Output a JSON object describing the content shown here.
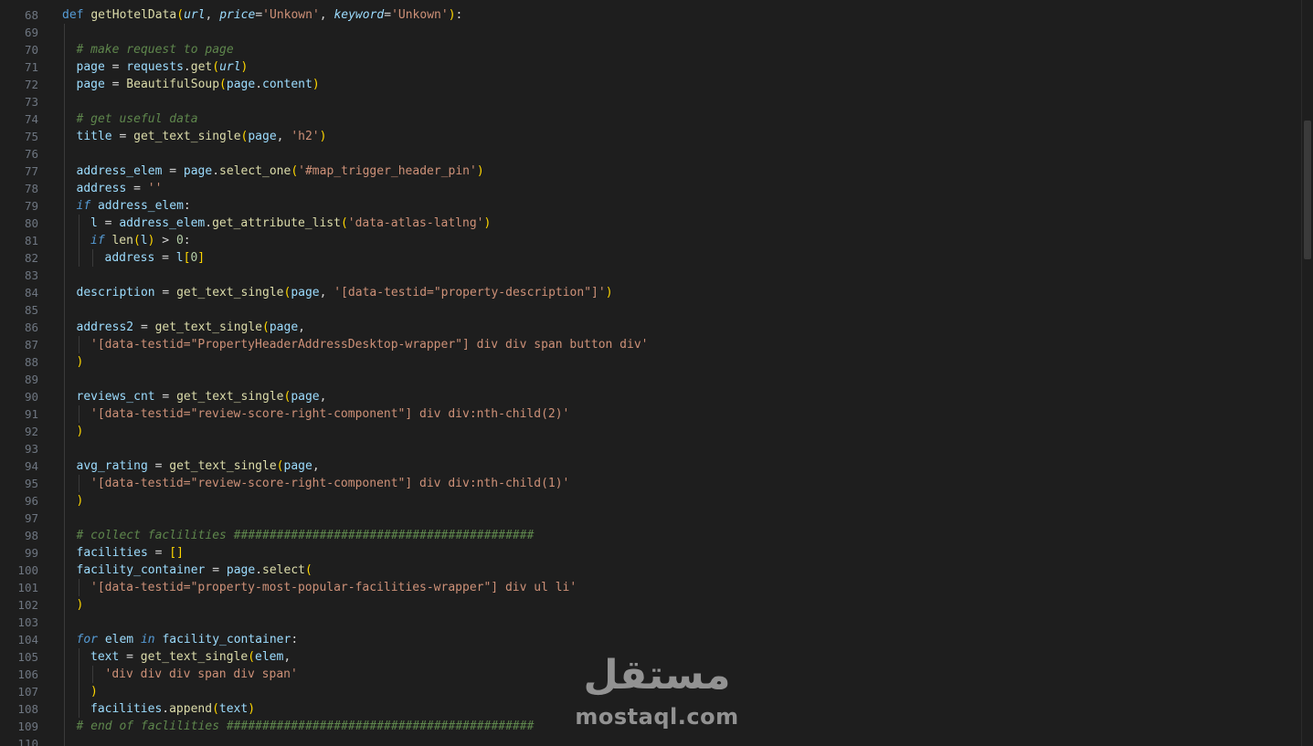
{
  "editor": {
    "line_numbers": [
      "68",
      "69",
      "70",
      "71",
      "72",
      "73",
      "74",
      "75",
      "76",
      "77",
      "78",
      "79",
      "80",
      "81",
      "82",
      "83",
      "84",
      "85",
      "86",
      "87",
      "88",
      "89",
      "90",
      "91",
      "92",
      "93",
      "94",
      "95",
      "96",
      "97",
      "98",
      "99",
      "100",
      "101",
      "102",
      "103",
      "104",
      "105",
      "106",
      "107",
      "108",
      "109",
      "110"
    ],
    "lines": [
      {
        "indent": 0,
        "tokens": [
          [
            "kw",
            "def "
          ],
          [
            "fn",
            "getHotelData"
          ],
          [
            "br1",
            "("
          ],
          [
            "prm",
            "url"
          ],
          [
            "punc",
            ", "
          ],
          [
            "prm",
            "price"
          ],
          [
            "op",
            "="
          ],
          [
            "str",
            "'Unkown'"
          ],
          [
            "punc",
            ", "
          ],
          [
            "prm",
            "keyword"
          ],
          [
            "op",
            "="
          ],
          [
            "str",
            "'Unkown'"
          ],
          [
            "br1",
            ")"
          ],
          [
            "punc",
            ":"
          ]
        ]
      },
      {
        "indent": 1,
        "tokens": []
      },
      {
        "indent": 1,
        "tokens": [
          [
            "com",
            "# make request to page"
          ]
        ]
      },
      {
        "indent": 1,
        "tokens": [
          [
            "var",
            "page"
          ],
          [
            "op",
            " = "
          ],
          [
            "var",
            "requests"
          ],
          [
            "punc",
            "."
          ],
          [
            "fn",
            "get"
          ],
          [
            "br1",
            "("
          ],
          [
            "prm",
            "url"
          ],
          [
            "br1",
            ")"
          ]
        ]
      },
      {
        "indent": 1,
        "tokens": [
          [
            "var",
            "page"
          ],
          [
            "op",
            " = "
          ],
          [
            "fn",
            "BeautifulSoup"
          ],
          [
            "br1",
            "("
          ],
          [
            "var",
            "page"
          ],
          [
            "punc",
            "."
          ],
          [
            "var",
            "content"
          ],
          [
            "br1",
            ")"
          ]
        ]
      },
      {
        "indent": 1,
        "tokens": []
      },
      {
        "indent": 1,
        "tokens": [
          [
            "com",
            "# get useful data"
          ]
        ]
      },
      {
        "indent": 1,
        "tokens": [
          [
            "var",
            "title"
          ],
          [
            "op",
            " = "
          ],
          [
            "fn",
            "get_text_single"
          ],
          [
            "br1",
            "("
          ],
          [
            "var",
            "page"
          ],
          [
            "punc",
            ", "
          ],
          [
            "str",
            "'h2'"
          ],
          [
            "br1",
            ")"
          ]
        ]
      },
      {
        "indent": 1,
        "tokens": []
      },
      {
        "indent": 1,
        "tokens": [
          [
            "var",
            "address_elem"
          ],
          [
            "op",
            " = "
          ],
          [
            "var",
            "page"
          ],
          [
            "punc",
            "."
          ],
          [
            "fn",
            "select_one"
          ],
          [
            "br1",
            "("
          ],
          [
            "str",
            "'#map_trigger_header_pin'"
          ],
          [
            "br1",
            ")"
          ]
        ]
      },
      {
        "indent": 1,
        "tokens": [
          [
            "var",
            "address"
          ],
          [
            "op",
            " = "
          ],
          [
            "str",
            "''"
          ]
        ]
      },
      {
        "indent": 1,
        "tokens": [
          [
            "kwi",
            "if "
          ],
          [
            "var",
            "address_elem"
          ],
          [
            "punc",
            ":"
          ]
        ]
      },
      {
        "indent": 2,
        "tokens": [
          [
            "var",
            "l"
          ],
          [
            "op",
            " = "
          ],
          [
            "var",
            "address_elem"
          ],
          [
            "punc",
            "."
          ],
          [
            "fn",
            "get_attribute_list"
          ],
          [
            "br1",
            "("
          ],
          [
            "str",
            "'data-atlas-latlng'"
          ],
          [
            "br1",
            ")"
          ]
        ]
      },
      {
        "indent": 2,
        "tokens": [
          [
            "kwi",
            "if "
          ],
          [
            "fn",
            "len"
          ],
          [
            "br1",
            "("
          ],
          [
            "var",
            "l"
          ],
          [
            "br1",
            ")"
          ],
          [
            "op",
            " > "
          ],
          [
            "num",
            "0"
          ],
          [
            "punc",
            ":"
          ]
        ]
      },
      {
        "indent": 3,
        "tokens": [
          [
            "var",
            "address"
          ],
          [
            "op",
            " = "
          ],
          [
            "var",
            "l"
          ],
          [
            "br1",
            "["
          ],
          [
            "num",
            "0"
          ],
          [
            "br1",
            "]"
          ]
        ]
      },
      {
        "indent": 1,
        "tokens": []
      },
      {
        "indent": 1,
        "tokens": [
          [
            "var",
            "description"
          ],
          [
            "op",
            " = "
          ],
          [
            "fn",
            "get_text_single"
          ],
          [
            "br1",
            "("
          ],
          [
            "var",
            "page"
          ],
          [
            "punc",
            ", "
          ],
          [
            "str",
            "'[data-testid=\"property-description\"]'"
          ],
          [
            "br1",
            ")"
          ]
        ]
      },
      {
        "indent": 1,
        "tokens": []
      },
      {
        "indent": 1,
        "tokens": [
          [
            "var",
            "address2"
          ],
          [
            "op",
            " = "
          ],
          [
            "fn",
            "get_text_single"
          ],
          [
            "br1",
            "("
          ],
          [
            "var",
            "page"
          ],
          [
            "punc",
            ","
          ]
        ]
      },
      {
        "indent": 2,
        "tokens": [
          [
            "str",
            "'[data-testid=\"PropertyHeaderAddressDesktop-wrapper\"] div div span button div'"
          ]
        ]
      },
      {
        "indent": 1,
        "tokens": [
          [
            "br1",
            ")"
          ]
        ]
      },
      {
        "indent": 1,
        "tokens": []
      },
      {
        "indent": 1,
        "tokens": [
          [
            "var",
            "reviews_cnt"
          ],
          [
            "op",
            " = "
          ],
          [
            "fn",
            "get_text_single"
          ],
          [
            "br1",
            "("
          ],
          [
            "var",
            "page"
          ],
          [
            "punc",
            ","
          ]
        ]
      },
      {
        "indent": 2,
        "tokens": [
          [
            "str",
            "'[data-testid=\"review-score-right-component\"] div div:nth-child(2)'"
          ]
        ]
      },
      {
        "indent": 1,
        "tokens": [
          [
            "br1",
            ")"
          ]
        ]
      },
      {
        "indent": 1,
        "tokens": []
      },
      {
        "indent": 1,
        "tokens": [
          [
            "var",
            "avg_rating"
          ],
          [
            "op",
            " = "
          ],
          [
            "fn",
            "get_text_single"
          ],
          [
            "br1",
            "("
          ],
          [
            "var",
            "page"
          ],
          [
            "punc",
            ","
          ]
        ]
      },
      {
        "indent": 2,
        "tokens": [
          [
            "str",
            "'[data-testid=\"review-score-right-component\"] div div:nth-child(1)'"
          ]
        ]
      },
      {
        "indent": 1,
        "tokens": [
          [
            "br1",
            ")"
          ]
        ]
      },
      {
        "indent": 1,
        "tokens": []
      },
      {
        "indent": 1,
        "tokens": [
          [
            "com",
            "# collect faclilities ##########################################"
          ]
        ]
      },
      {
        "indent": 1,
        "tokens": [
          [
            "var",
            "facilities"
          ],
          [
            "op",
            " = "
          ],
          [
            "br1",
            "[]"
          ]
        ]
      },
      {
        "indent": 1,
        "tokens": [
          [
            "var",
            "facility_container"
          ],
          [
            "op",
            " = "
          ],
          [
            "var",
            "page"
          ],
          [
            "punc",
            "."
          ],
          [
            "fn",
            "select"
          ],
          [
            "br1",
            "("
          ]
        ]
      },
      {
        "indent": 2,
        "tokens": [
          [
            "str",
            "'[data-testid=\"property-most-popular-facilities-wrapper\"] div ul li'"
          ]
        ]
      },
      {
        "indent": 1,
        "tokens": [
          [
            "br1",
            ")"
          ]
        ]
      },
      {
        "indent": 1,
        "tokens": []
      },
      {
        "indent": 1,
        "tokens": [
          [
            "kwi",
            "for "
          ],
          [
            "var",
            "elem "
          ],
          [
            "kwi",
            "in "
          ],
          [
            "var",
            "facility_container"
          ],
          [
            "punc",
            ":"
          ]
        ]
      },
      {
        "indent": 2,
        "tokens": [
          [
            "var",
            "text"
          ],
          [
            "op",
            " = "
          ],
          [
            "fn",
            "get_text_single"
          ],
          [
            "br1",
            "("
          ],
          [
            "var",
            "elem"
          ],
          [
            "punc",
            ","
          ]
        ]
      },
      {
        "indent": 3,
        "tokens": [
          [
            "str",
            "'div div div span div span'"
          ]
        ]
      },
      {
        "indent": 2,
        "tokens": [
          [
            "br1",
            ")"
          ]
        ]
      },
      {
        "indent": 2,
        "tokens": [
          [
            "var",
            "facilities"
          ],
          [
            "punc",
            "."
          ],
          [
            "fn",
            "append"
          ],
          [
            "br1",
            "("
          ],
          [
            "var",
            "text"
          ],
          [
            "br1",
            ")"
          ]
        ]
      },
      {
        "indent": 1,
        "tokens": [
          [
            "com",
            "# end of faclilities ###########################################"
          ]
        ]
      },
      {
        "indent": 1,
        "tokens": []
      }
    ]
  },
  "watermark": {
    "arabic": "مستقل",
    "latin": "mostaql.com"
  }
}
